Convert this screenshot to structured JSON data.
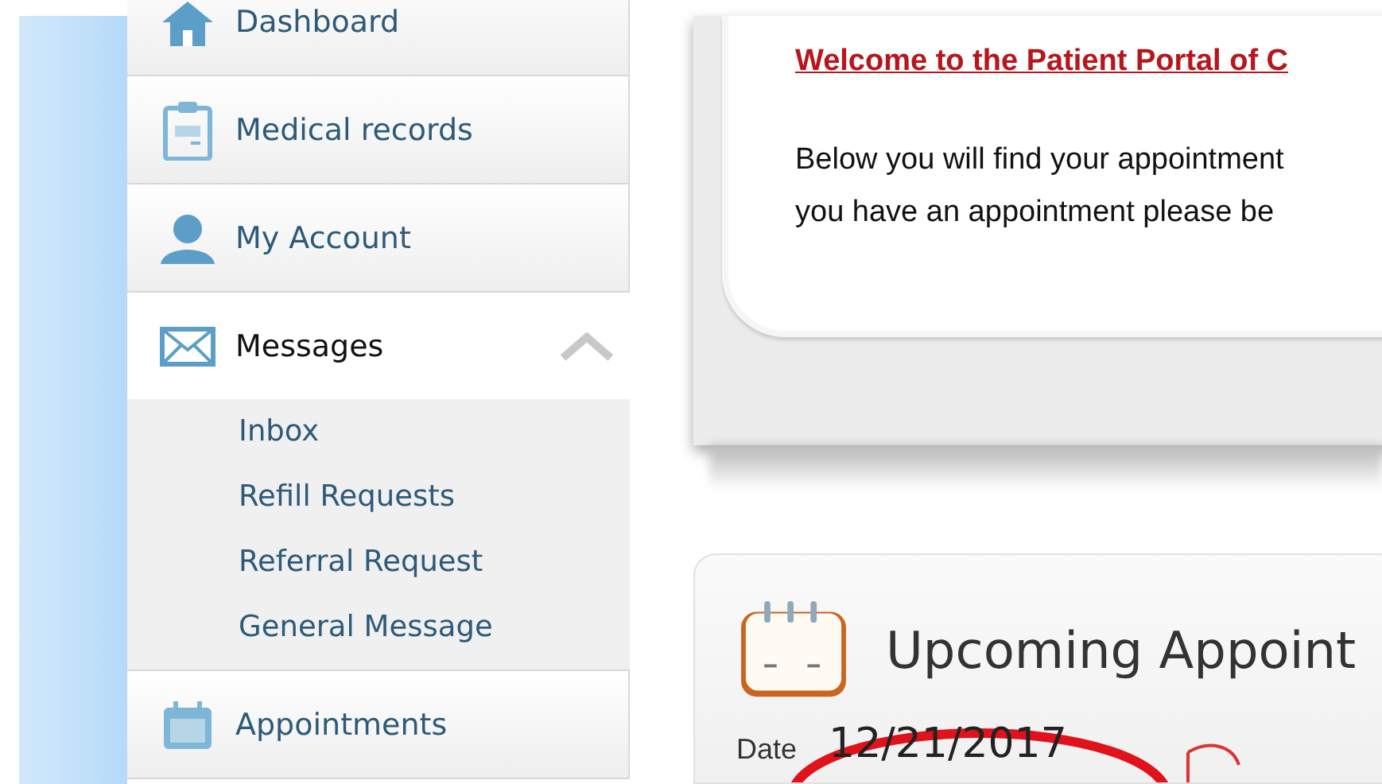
{
  "sidebar": {
    "items": [
      {
        "label": "Dashboard",
        "expanded": false
      },
      {
        "label": "Medical records",
        "expanded": false
      },
      {
        "label": "My Account",
        "expanded": false
      },
      {
        "label": "Messages",
        "expanded": true,
        "children": [
          {
            "label": "Inbox"
          },
          {
            "label": "Refill Requests"
          },
          {
            "label": "Referral Request"
          },
          {
            "label": "General Message"
          }
        ]
      },
      {
        "label": "Appointments",
        "expanded": false
      }
    ]
  },
  "welcome": {
    "title": "Welcome to the Patient Portal of C",
    "lines": [
      "Below you will find your appointment",
      "you have an appointment please be"
    ]
  },
  "appointments": {
    "title": "Upcoming Appoint",
    "date_label": "Date",
    "date": "12/21/2017"
  }
}
